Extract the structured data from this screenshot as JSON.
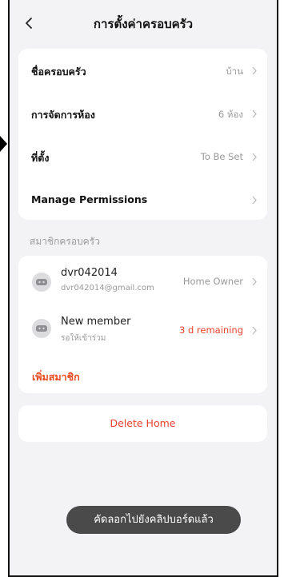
{
  "header": {
    "title": "การตั้งค่าครอบครัว"
  },
  "settings": {
    "items": [
      {
        "label": "ชื่อครอบครัว",
        "value": "บ้าน"
      },
      {
        "label": "การจัดการห้อง",
        "value": "6 ห้อง"
      },
      {
        "label": "ที่ตั้ง",
        "value": "To Be Set"
      },
      {
        "label": "Manage Permissions",
        "value": ""
      }
    ]
  },
  "members": {
    "section_title": "สมาชิกครอบครัว",
    "items": [
      {
        "name": "dvr042014",
        "sub": "dvr042014@gmail.com",
        "role": "Home Owner"
      },
      {
        "name": "New member",
        "sub": "รอให้เข้าร่วม",
        "role": "3 d remaining"
      }
    ],
    "add_label": "เพิ่มสมาชิก"
  },
  "delete_label": "Delete Home",
  "toast": "คัดลอกไปยังคลิปบอร์ดแล้ว",
  "colors": {
    "accent": "#e8412c",
    "background": "#f3f3f5",
    "toast": "#4a4a4a"
  }
}
